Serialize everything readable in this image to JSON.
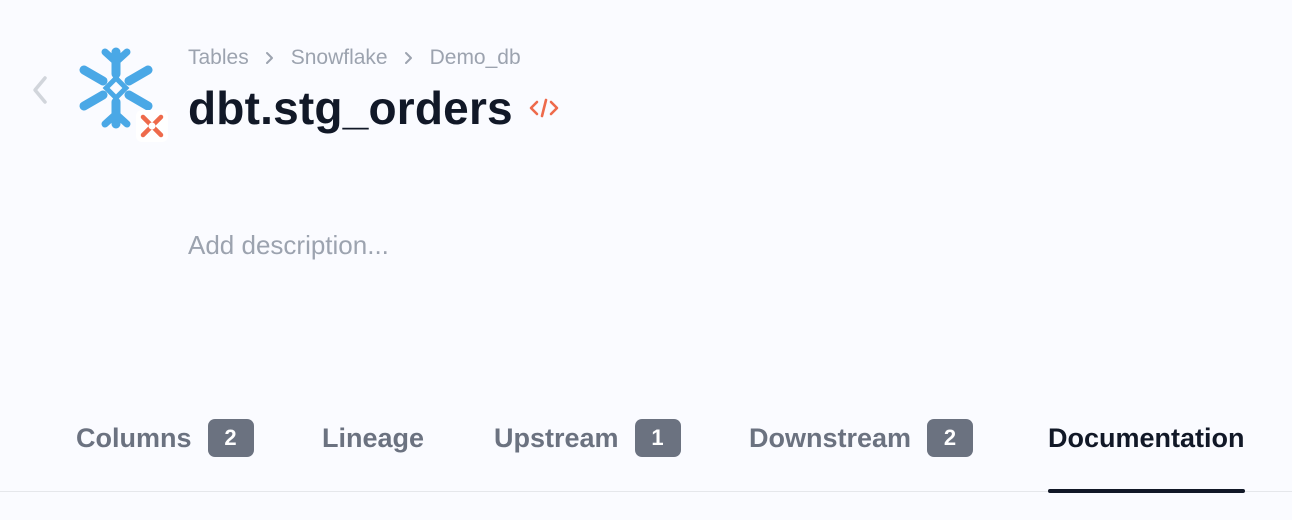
{
  "breadcrumb": {
    "items": [
      "Tables",
      "Snowflake",
      "Demo_db"
    ]
  },
  "title": "dbt.stg_orders",
  "description": {
    "placeholder": "Add description..."
  },
  "tabs": [
    {
      "label": "Columns",
      "count": "2"
    },
    {
      "label": "Lineage"
    },
    {
      "label": "Upstream",
      "count": "1"
    },
    {
      "label": "Downstream",
      "count": "2"
    },
    {
      "label": "Documentation",
      "active": true
    }
  ],
  "icons": {
    "back": "chevron-left-icon",
    "logo": "snowflake-icon",
    "badge": "dbt-icon",
    "code": "code-icon"
  },
  "colors": {
    "snowflake": "#4aa8e6",
    "dbt": "#ee6a4b",
    "active_tab": "#111827",
    "badge_bg": "#6b7280"
  }
}
